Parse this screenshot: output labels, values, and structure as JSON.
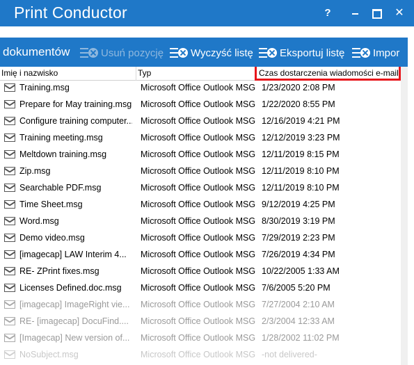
{
  "window": {
    "title": "Print Conductor",
    "help_label": "?",
    "close_label": "✕"
  },
  "toolbar": {
    "documents_label": "dokumentów",
    "remove_label": "Usuń pozycję",
    "clear_label": "Wyczyść listę",
    "export_label": "Eksportuj listę",
    "import_label": "Impor"
  },
  "columns": {
    "name": "Imię i nazwisko",
    "type": "Typ",
    "delivery": "Czas dostarczenia wiadomości e-mail"
  },
  "rows": [
    {
      "name": "Training.msg",
      "type": "Microsoft Office Outlook MSG",
      "date": "1/23/2020 2:08 PM"
    },
    {
      "name": "Prepare for May training.msg",
      "type": "Microsoft Office Outlook MSG",
      "date": "1/22/2020 8:55 PM"
    },
    {
      "name": "Configure training computer...",
      "type": "Microsoft Office Outlook MSG",
      "date": "12/16/2019 4:21 PM"
    },
    {
      "name": "Training meeting.msg",
      "type": "Microsoft Office Outlook MSG",
      "date": "12/12/2019 3:23 PM"
    },
    {
      "name": "Meltdown training.msg",
      "type": "Microsoft Office Outlook MSG",
      "date": "12/11/2019 8:15 PM"
    },
    {
      "name": "Zip.msg",
      "type": "Microsoft Office Outlook MSG",
      "date": "12/11/2019 8:10 PM"
    },
    {
      "name": "Searchable PDF.msg",
      "type": "Microsoft Office Outlook MSG",
      "date": "12/11/2019 8:10 PM"
    },
    {
      "name": "Time Sheet.msg",
      "type": "Microsoft Office Outlook MSG",
      "date": "9/12/2019 4:25 PM"
    },
    {
      "name": "Word.msg",
      "type": "Microsoft Office Outlook MSG",
      "date": "8/30/2019 3:19 PM"
    },
    {
      "name": "Demo video.msg",
      "type": "Microsoft Office Outlook MSG",
      "date": "7/29/2019 2:23 PM"
    },
    {
      "name": "[imagecap] LAW Interim 4...",
      "type": "Microsoft Office Outlook MSG",
      "date": "7/26/2019 4:34 PM"
    },
    {
      "name": "RE- ZPrint fixes.msg",
      "type": "Microsoft Office Outlook MSG",
      "date": "10/22/2005 1:33 AM"
    },
    {
      "name": "Licenses Defined.doc.msg",
      "type": "Microsoft Office Outlook MSG",
      "date": "7/6/2005 5:20 PM"
    },
    {
      "name": "[imagecap] ImageRight vie...",
      "type": "Microsoft Office Outlook MSG",
      "date": "7/27/2004 2:10 AM"
    },
    {
      "name": "RE- [imagecap] DocuFind....",
      "type": "Microsoft Office Outlook MSG",
      "date": "2/3/2004 12:33 AM"
    },
    {
      "name": "[Imagecap] New version of...",
      "type": "Microsoft Office Outlook MSG",
      "date": "1/28/2002 11:02 PM"
    },
    {
      "name": "NoSubject.msg",
      "type": "Microsoft Office Outlook MSG",
      "date": "-not delivered-"
    }
  ],
  "colors": {
    "accent": "#1f78c8",
    "highlight": "#e8151b"
  }
}
